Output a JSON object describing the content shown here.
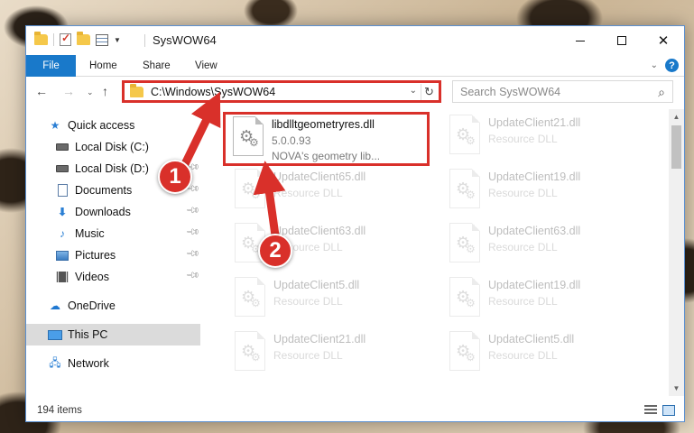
{
  "window": {
    "title": "SysWOW64"
  },
  "ribbon": {
    "file_tab": "File",
    "home_tab": "Home",
    "share_tab": "Share",
    "view_tab": "View"
  },
  "nav": {
    "address": "C:\\Windows\\SysWOW64",
    "search_placeholder": "Search SysWOW64"
  },
  "sidebar": {
    "items": [
      {
        "label": "Quick access",
        "icon": "star-icon"
      },
      {
        "label": "Local Disk (C:)",
        "icon": "disk-icon"
      },
      {
        "label": "Local Disk (D:)",
        "icon": "disk-icon"
      },
      {
        "label": "Documents",
        "icon": "documents-icon"
      },
      {
        "label": "Downloads",
        "icon": "downloads-icon"
      },
      {
        "label": "Music",
        "icon": "music-icon"
      },
      {
        "label": "Pictures",
        "icon": "pictures-icon"
      },
      {
        "label": "Videos",
        "icon": "videos-icon"
      },
      {
        "label": "OneDrive",
        "icon": "onedrive-icon"
      },
      {
        "label": "This PC",
        "icon": "this-pc-icon"
      },
      {
        "label": "Network",
        "icon": "network-icon"
      }
    ]
  },
  "files": [
    {
      "name": "libdlltgeometryres.dll",
      "version": "5.0.0.93",
      "desc": "NOVA's geometry lib..."
    },
    {
      "name": "UpdateClient21.dll",
      "desc": "Resource DLL"
    },
    {
      "name": "UpdateClient65.dll",
      "desc": "Resource DLL"
    },
    {
      "name": "UpdateClient19.dll",
      "desc": "Resource DLL"
    },
    {
      "name": "UpdateClient63.dll",
      "desc": "Resource DLL"
    },
    {
      "name": "UpdateClient63.dll",
      "desc": "Resource DLL"
    },
    {
      "name": "UpdateClient5.dll",
      "desc": "Resource DLL"
    },
    {
      "name": "UpdateClient19.dll",
      "desc": "Resource DLL"
    },
    {
      "name": "UpdateClient21.dll",
      "desc": "Resource DLL"
    },
    {
      "name": "UpdateClient5.dll",
      "desc": "Resource DLL"
    }
  ],
  "status": {
    "item_count": "194 items"
  },
  "annotations": {
    "step1": "1",
    "step2": "2",
    "color": "#d9302a"
  }
}
